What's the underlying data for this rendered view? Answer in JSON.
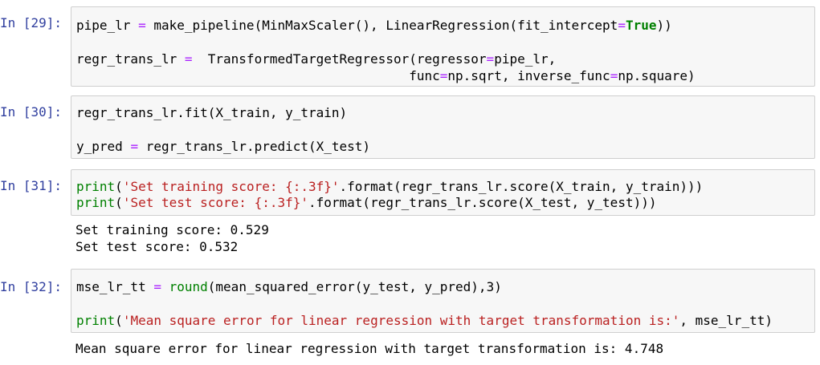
{
  "cells": [
    {
      "prompt": "In [29]:",
      "code": [
        "pipe_lr = make_pipeline(MinMaxScaler(), LinearRegression(fit_intercept=True))",
        "",
        "regr_trans_lr =  TransformedTargetRegressor(regressor=pipe_lr,",
        "                                           func=np.sqrt, inverse_func=np.square)"
      ],
      "output": []
    },
    {
      "prompt": "In [30]:",
      "code": [
        "regr_trans_lr.fit(X_train, y_train)",
        "",
        "y_pred = regr_trans_lr.predict(X_test)"
      ],
      "output": []
    },
    {
      "prompt": "In [31]:",
      "code": [
        "print('Set training score: {:.3f}'.format(regr_trans_lr.score(X_train, y_train)))",
        "print('Set test score: {:.3f}'.format(regr_trans_lr.score(X_test, y_test)))"
      ],
      "output": [
        "Set training score: 0.529",
        "Set test score: 0.532"
      ]
    },
    {
      "prompt": "In [32]:",
      "code": [
        "mse_lr_tt = round(mean_squared_error(y_test, y_pred),3)",
        "",
        "print('Mean square error for linear regression with target transformation is:', mse_lr_tt)"
      ],
      "output": [
        "Mean square error for linear regression with target transformation is: 4.748"
      ]
    }
  ],
  "colors": {
    "prompt": "#303f9f",
    "input_bg": "#f7f7f7",
    "input_border": "#cfcfcf",
    "string": "#ba2121",
    "builtin": "#008000",
    "operator": "#aa22ff"
  }
}
